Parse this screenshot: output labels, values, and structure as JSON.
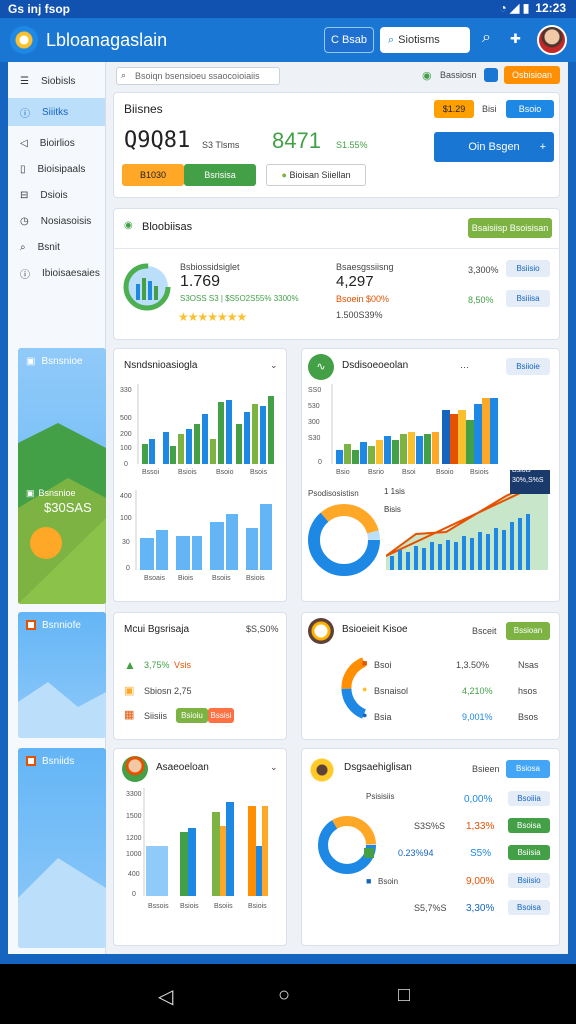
{
  "status": {
    "left": "Gs inj fsop",
    "time": "12:23"
  },
  "appbar": {
    "title": "Lbloanagaslain",
    "btn_c": "C Bsab",
    "search_text": "Siotisms"
  },
  "sidebar": {
    "items": [
      {
        "icon": "list-icon",
        "label": "Siobisls"
      },
      {
        "icon": "info-icon",
        "label": "Siiitks"
      },
      {
        "icon": "send-icon",
        "label": "Bioirlios"
      },
      {
        "icon": "doc-icon",
        "label": "Bioisipaals"
      },
      {
        "icon": "db-icon",
        "label": "Dsiois"
      },
      {
        "icon": "clock-icon",
        "label": "Nosiasoisis"
      },
      {
        "icon": "search-icon",
        "label": "Bsnit"
      },
      {
        "icon": "info-icon",
        "label": "Ibioisaesaies"
      }
    ],
    "cards": [
      {
        "title": "Bsnsnioe",
        "value": "$30SAS"
      },
      {
        "title": "Bsnniofe"
      },
      {
        "title": "Bsniids"
      }
    ]
  },
  "toolbar": {
    "search": "Bsoiqn bsensioeu ssaocoioiaiis",
    "status_label": "Bassiosn",
    "action": "Osbisioan"
  },
  "summary": {
    "title": "Biisnes",
    "value1": "Q9Q81",
    "sub1": "S3 Tlsms",
    "value2": "8471",
    "sub2": "S1.55%",
    "chip_orange": "$1.29",
    "chip_text": "Bisi",
    "chip_blue": "Bsoio",
    "tab1": "B1030",
    "tab2": "Bsrisisa",
    "tab3": "Bioisan Siiellan",
    "primary": "Oin Bsgen"
  },
  "blocks": {
    "title": "Bloobiisas",
    "button": "Bsaisiisp Bsoisisan",
    "left_label": "Bsbiossidsiglet",
    "left_value": "1.769",
    "left_sub": "S3OSS S3 | $S5O2S55% 3300%",
    "right_label": "Bsaesgssiisng",
    "right_value": "4,297",
    "right_sub": "Bsoein $00%",
    "right_sub2": "1.500S39%",
    "pct1": "3,300%",
    "pct2": "8,50%",
    "btn1": "Bsiisio",
    "btn2": "Bsiiisa"
  },
  "chart1": {
    "title": "Nsndsnioasiogla",
    "y_ticks": [
      "330",
      "500",
      "200",
      "100",
      "0"
    ],
    "x_ticks": [
      "Bssoi",
      "Bsiois",
      "Bsoio",
      "Bsois"
    ],
    "bottom_y": [
      "400",
      "100",
      "30",
      "0"
    ],
    "bottom_x": [
      "Bsoais",
      "Biois",
      "Bsoiis",
      "Bsiois"
    ]
  },
  "chart2": {
    "title": "Dsdisoeoeolan",
    "pill": "Bsiioie",
    "y_ticks": [
      "SS0",
      "530",
      "300",
      "S30",
      "0"
    ],
    "x_ticks": [
      "Bsio",
      "Bsrio",
      "Bsoi",
      "Bsoio",
      "Bsiois"
    ],
    "donut_label": "Psodisosistisn",
    "callout": "Bsiois",
    "callout2": "30%,S%S",
    "legend": "1 1sis",
    "legend2": "Bisis"
  },
  "card3": {
    "title": "Mcui Bgsrisaja",
    "value": "$S,S0%",
    "r1_val": "3,75%",
    "r1_sub": "Vsis",
    "r2": "Sbiosn",
    "r2_val": "2,75",
    "r3": "Siisiis",
    "r3_tag": "Bsioiu",
    "r3_tag2": "Bssisi"
  },
  "card4": {
    "title": "Bsioeieit Kisoe",
    "chip": "Bsceit",
    "btn": "Bssioan",
    "rows": [
      {
        "label": "Bsoi",
        "val": "1,3.50%",
        "tag": "Nsas"
      },
      {
        "label": "Bsnaisol",
        "val": "4,210%",
        "tag": "hsos"
      },
      {
        "label": "Bsia",
        "val": "9,001%",
        "tag": "Bsos"
      }
    ]
  },
  "card5": {
    "title": "Asaeoeloan",
    "y_ticks": [
      "3300",
      "1500",
      "1200",
      "1000",
      "400",
      "0"
    ],
    "x_ticks": [
      "Bssois",
      "Bsiois",
      "Bsoiis",
      "Bsiois"
    ]
  },
  "card6": {
    "title": "Dsgsaehiglisan",
    "chip": "Bsieen",
    "btn": "Bsiosa",
    "sub_label": "Psisisiis",
    "rows": [
      {
        "left": "",
        "val": "0,00%",
        "btn": "Bsoiiia"
      },
      {
        "left": "S3S%S",
        "val": "1,33%",
        "btn": "Bsoisa"
      },
      {
        "left": "0.23%94",
        "val": "S5%",
        "btn": "Bsiisia"
      },
      {
        "left": "",
        "val": "9,00%",
        "btn": "Bsiisio"
      },
      {
        "left": "S5,7%S",
        "val": "3,30%",
        "btn": "Bsoisa"
      }
    ],
    "legend": "Bsoin"
  }
}
